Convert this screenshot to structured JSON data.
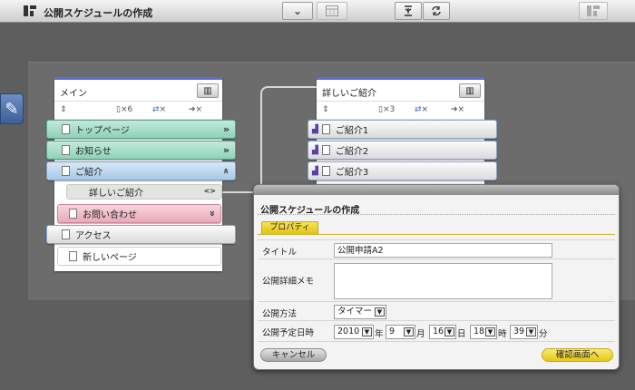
{
  "topbar": {
    "title": "公開スケジュールの作成",
    "chevron": "⌄"
  },
  "left_column": {
    "name": "メイン",
    "page_count": "×6",
    "link_count": "×",
    "move_count": "×",
    "items": [
      {
        "label": "トップページ",
        "arrow": "»"
      },
      {
        "label": "お知らせ",
        "arrow": "»"
      },
      {
        "label": "ご紹介",
        "arrow": "«"
      },
      {
        "label": "詳しいご紹介",
        "arrow": "<>"
      },
      {
        "label": "お問い合わせ",
        "arrow": "«"
      },
      {
        "label": "アクセス"
      },
      {
        "label": "新しいページ"
      }
    ]
  },
  "right_column": {
    "name": "詳しいご紹介",
    "page_count": "×3",
    "link_count": "×",
    "move_count": "×",
    "items": [
      {
        "label": "ご紹介1"
      },
      {
        "label": "ご紹介2"
      },
      {
        "label": "ご紹介3"
      }
    ]
  },
  "dialog": {
    "title": "公開スケジュールの作成",
    "tab": "プロパティ",
    "title_label": "タイトル",
    "title_value": "公開申請A2",
    "memo_label": "公開詳細メモ",
    "memo_value": "",
    "method_label": "公開方法",
    "method_value": "タイマー",
    "datetime_label": "公開予定日時",
    "year": "2010",
    "year_unit": "年",
    "month": "9",
    "month_unit": "月",
    "day": "16",
    "day_unit": "日",
    "hour": "18",
    "hour_unit": "時",
    "minute": "39",
    "minute_unit": "分",
    "cancel": "キャンセル",
    "confirm": "確認画面へ"
  }
}
